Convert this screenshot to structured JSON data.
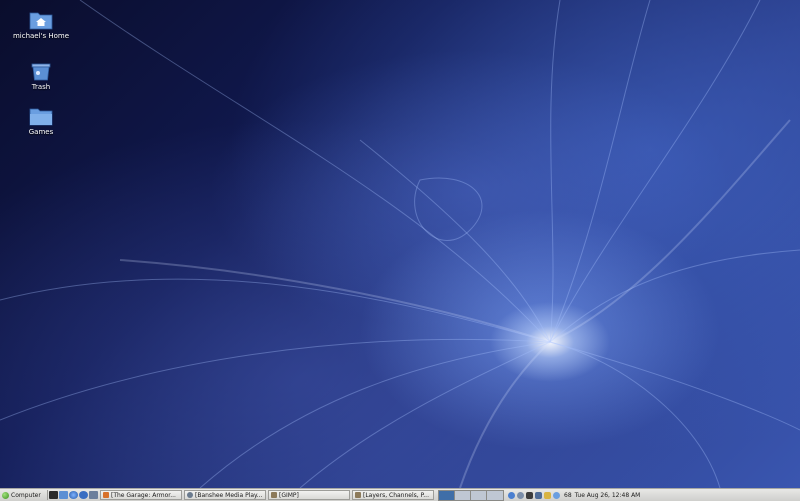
{
  "desktop": {
    "icons": [
      {
        "label": "michael's Home",
        "icon": "home-folder-icon"
      },
      {
        "label": "Trash",
        "icon": "trash-icon"
      },
      {
        "label": "Games",
        "icon": "folder-icon"
      }
    ]
  },
  "taskbar": {
    "menu_label": "Computer",
    "launchers": [
      "terminal-icon",
      "folder-icon",
      "browser-icon",
      "search-icon",
      "help-icon"
    ],
    "tasks": [
      {
        "label": "[The Garage: Armor...",
        "icon": "firefox-icon"
      },
      {
        "label": "[Banshee Media Play...",
        "icon": "banshee-icon"
      },
      {
        "label": "[GIMP]",
        "icon": "gimp-icon"
      },
      {
        "label": "[Layers, Channels, P...",
        "icon": "gimp-icon"
      }
    ],
    "workspaces": 4,
    "active_workspace": 1,
    "tray_icons": [
      "network-icon",
      "update-icon",
      "battery-icon",
      "display-icon",
      "chat-icon",
      "clock-icon"
    ],
    "volume": "68",
    "clock": "Tue Aug 26, 12:48 AM"
  },
  "colors": {
    "taskbar_bg": "#d9d9d6",
    "folder_blue": "#5b8fd4",
    "active_workspace": "#3f6ea8"
  }
}
